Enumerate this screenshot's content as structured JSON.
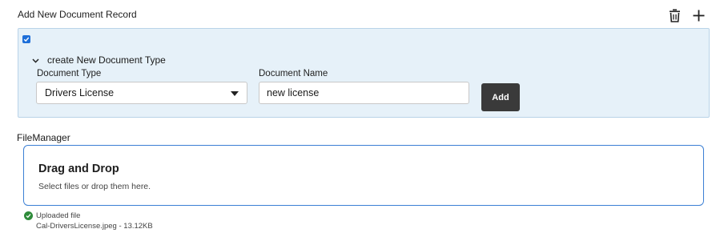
{
  "page": {
    "title": "Add New Document Record"
  },
  "header_actions": {
    "delete_icon": "trash-icon",
    "add_icon": "plus-icon"
  },
  "record": {
    "checked": true,
    "section_label": "create New Document Type",
    "document_type": {
      "label": "Document Type",
      "selected": "Drivers License"
    },
    "document_name": {
      "label": "Document Name",
      "value": "new license"
    },
    "add_button": "Add"
  },
  "file_manager": {
    "label": "FileManager",
    "dropzone_title": "Drag and Drop",
    "dropzone_hint": "Select files or drop them here.",
    "status": "Uploaded file",
    "file": "Cal-DriversLicense.jpeg - 13.12KB"
  },
  "colors": {
    "panel_bg": "#e6f1f9",
    "accent": "#3b7fd4",
    "button_bg": "#3a3a3a",
    "success": "#2e8b3a"
  }
}
